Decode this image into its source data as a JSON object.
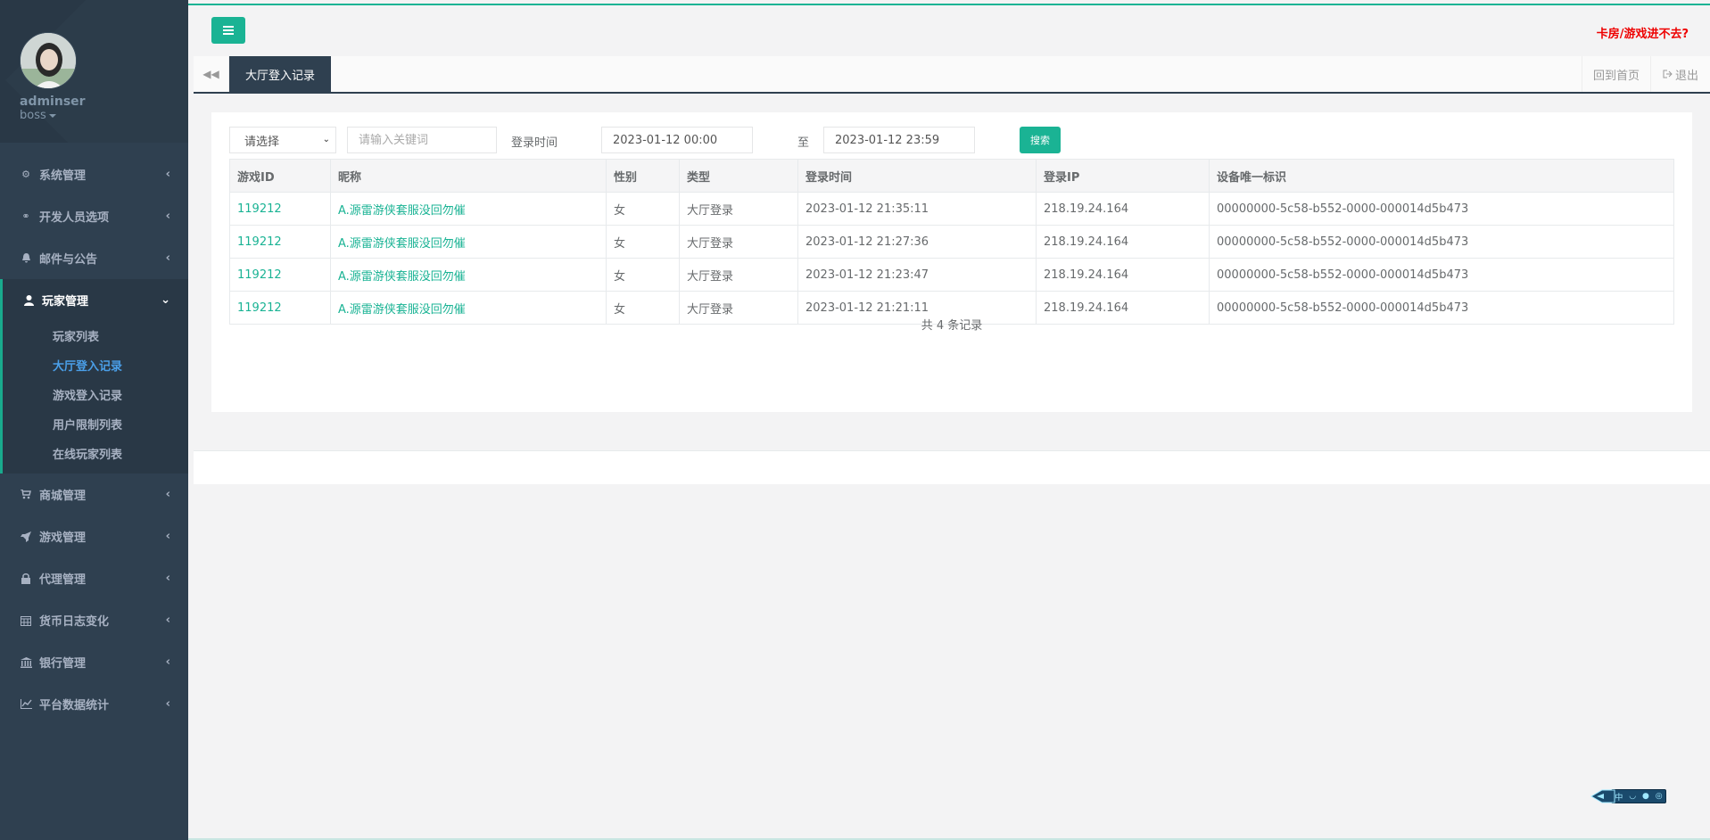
{
  "profile": {
    "name": "adminser",
    "role": "boss"
  },
  "menu": {
    "items": [
      {
        "label": "系统管理",
        "icon": "gears-icon"
      },
      {
        "label": "开发人员选项",
        "icon": "link-icon"
      },
      {
        "label": "邮件与公告",
        "icon": "bell-icon"
      },
      {
        "label": "玩家管理",
        "icon": "user-icon"
      },
      {
        "label": "商城管理",
        "icon": "cart-icon"
      },
      {
        "label": "游戏管理",
        "icon": "rocket-icon"
      },
      {
        "label": "代理管理",
        "icon": "lock-icon"
      },
      {
        "label": "货币日志变化",
        "icon": "calendar-icon"
      },
      {
        "label": "银行管理",
        "icon": "bank-icon"
      },
      {
        "label": "平台数据统计",
        "icon": "line-chart-icon"
      }
    ],
    "sub_items": [
      "玩家列表",
      "大厅登入记录",
      "游戏登入记录",
      "用户限制列表",
      "在线玩家列表"
    ]
  },
  "topbar": {
    "help_link": "卡房/游戏进不去?"
  },
  "tabs": {
    "active": "大厅登入记录",
    "home": "回到首页",
    "logout": "退出"
  },
  "filter": {
    "select": "请选择",
    "keyword_placeholder": "请输入关键词",
    "time_label": "登录时间",
    "start_time": "2023-01-12 00:00",
    "to_label": "至",
    "end_time": "2023-01-12 23:59",
    "search_button": "搜索"
  },
  "table": {
    "headers": [
      "游戏ID",
      "昵称",
      "性别",
      "类型",
      "登录时间",
      "登录IP",
      "设备唯一标识"
    ],
    "rows": [
      [
        "119212",
        "A.源雷游侠套服没回勿催",
        "女",
        "大厅登录",
        "2023-01-12 21:35:11",
        "218.19.24.164",
        "00000000-5c58-b552-0000-000014d5b473"
      ],
      [
        "119212",
        "A.源雷游侠套服没回勿催",
        "女",
        "大厅登录",
        "2023-01-12 21:27:36",
        "218.19.24.164",
        "00000000-5c58-b552-0000-000014d5b473"
      ],
      [
        "119212",
        "A.源雷游侠套服没回勿催",
        "女",
        "大厅登录",
        "2023-01-12 21:23:47",
        "218.19.24.164",
        "00000000-5c58-b552-0000-000014d5b473"
      ],
      [
        "119212",
        "A.源雷游侠套服没回勿催",
        "女",
        "大厅登录",
        "2023-01-12 21:21:11",
        "218.19.24.164",
        "00000000-5c58-b552-0000-000014d5b473"
      ]
    ],
    "total": "共 4 条记录"
  },
  "colors": {
    "accent": "#1ab394",
    "sidebar": "#2f4050",
    "sidebar_dark": "#293846",
    "alert": "#ee0000",
    "current_sub": "#4a9fe8"
  }
}
